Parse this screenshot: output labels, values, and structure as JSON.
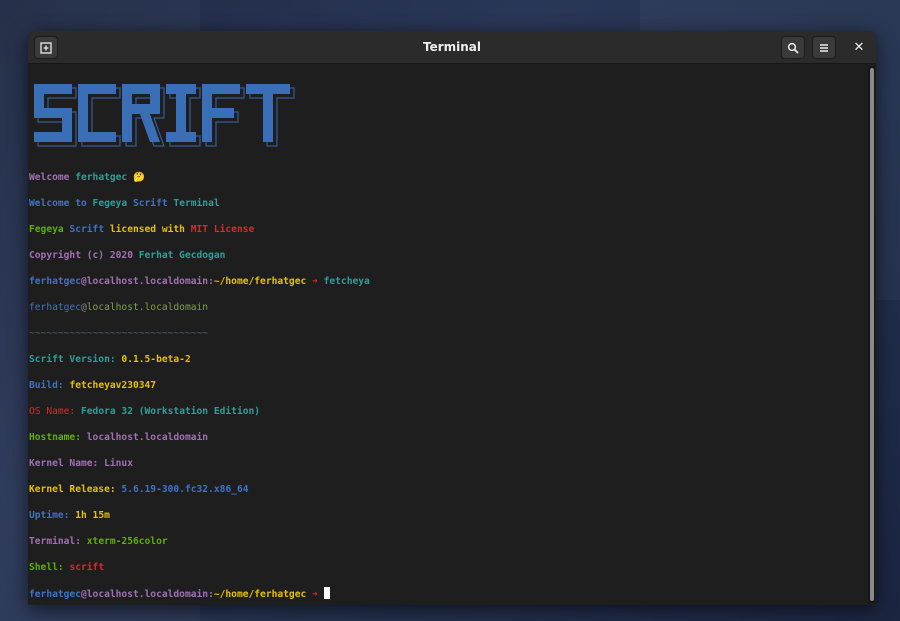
{
  "window": {
    "title": "Terminal",
    "new_tab_icon": "new-tab-icon",
    "search_icon": "search-icon",
    "menu_icon": "hamburger-menu-icon",
    "close_icon": "close-icon"
  },
  "logo": {
    "text": "SCRIFT"
  },
  "welcome": {
    "welcome_word": "Welcome",
    "user": "ferhatgec",
    "emoji": "🤔",
    "line2_a": "Welcome to",
    "line2_b": "Fegeya",
    "line2_c": "Scrift",
    "line2_d": "Terminal",
    "line3_a": "Fegeya",
    "line3_b": "Scrift",
    "line3_c": "licensed with",
    "line3_d": "MIT License",
    "line4_a": "Copyright (c) 2020",
    "line4_b": "Ferhat Gecdogan"
  },
  "prompt1": {
    "user": "ferhatgec",
    "at": "@",
    "host": "localhost.localdomain",
    "colon": ":",
    "path": "~/home/ferhatgec",
    "arrow": "➜",
    "command": "fetcheya"
  },
  "fetch": {
    "user": "ferhatgec",
    "at": "@",
    "host": "localhost.localdomain",
    "separator": "~~~~~~~~~~~~~~~~~~~~~~~~~~~~~~~",
    "rows": [
      {
        "key": "Scrift Version:",
        "value": "0.1.5-beta-2"
      },
      {
        "key": "Build:",
        "value": "fetcheyav230347"
      },
      {
        "key": "OS Name:",
        "value": "Fedora 32 (Workstation Edition)"
      },
      {
        "key": "Hostname:",
        "value": "localhost.localdomain"
      },
      {
        "key": "Kernel Name:",
        "value": "Linux"
      },
      {
        "key": "Kernel Release:",
        "value": "5.6.19-300.fc32.x86_64"
      },
      {
        "key": "Uptime:",
        "value": "1h 15m"
      },
      {
        "key": "Terminal:",
        "value": "xterm-256color"
      },
      {
        "key": "Shell:",
        "value": "scrift"
      }
    ]
  },
  "prompt2": {
    "user": "ferhatgec",
    "at": "@",
    "host": "localhost.localdomain",
    "colon": ":",
    "path": "~/home/ferhatgec",
    "arrow": "➜"
  },
  "colors": {
    "accent_blue": "#3f72c9",
    "purple": "#a170b3",
    "teal": "#2aa198",
    "green": "#5faf00",
    "yellow": "#e5c100",
    "red": "#d62c2c"
  }
}
